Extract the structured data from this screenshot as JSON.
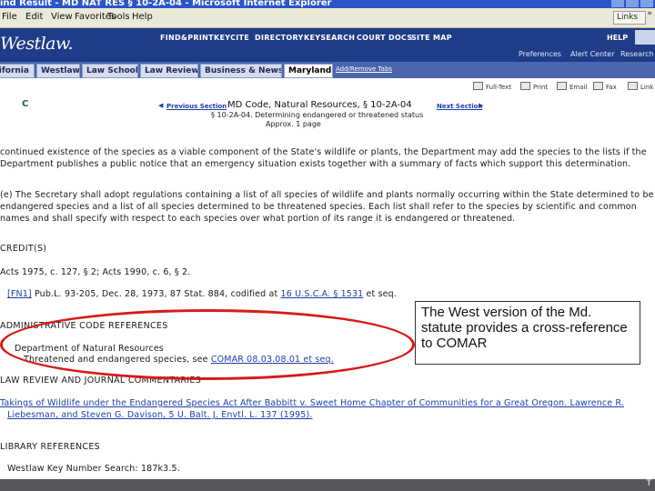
{
  "window": {
    "title": "ind Result - MD NAT RES § 10-2A-04 - Microsoft Internet Explorer"
  },
  "menu": {
    "items": [
      "File",
      "Edit",
      "View",
      "Favorites",
      "Tools",
      "Help"
    ],
    "links_label": "Links"
  },
  "westlaw": {
    "logo": "Westlaw.",
    "nav": [
      "FIND&PRINT",
      "KEYCITE",
      "DIRECTORY",
      "KEYSEARCH",
      "COURT DOCS",
      "SITE MAP"
    ],
    "help": "HELP",
    "sub_links": [
      "Preferences",
      "Alert Center",
      "Research Trail"
    ]
  },
  "tabs": {
    "items": [
      "California",
      "Westlaw",
      "Law School",
      "Law Review",
      "Business & News",
      "Maryland"
    ],
    "active": "Maryland",
    "add_remove": "Add/Remove Tabs"
  },
  "document": {
    "flag": "C",
    "prev_section": "Previous Section",
    "next_section": "Next Section",
    "title": "MD Code, Natural Resources, § 10-2A-04",
    "subtitle": "§ 10-2A-04. Determining endangered or threatened status",
    "length": "Approx. 1 page",
    "tools": [
      "Full-Text",
      "Print",
      "Email",
      "Fax",
      "Link"
    ]
  },
  "body": {
    "para1": [
      "continued existence of the species as a viable component of the State's wildlife or plants, the Department may add the species to the lists if the",
      "Department publishes a public notice that an emergency situation exists together with a summary of facts which support this determination."
    ],
    "para2": [
      "(e) The Secretary shall adopt regulations containing a list of all species of wildlife and plants normally occurring within the State determined to be",
      "endangered species and a list of all species determined to be threatened species. Each list shall refer to the species by scientific and common",
      "names and shall specify with respect to each species over what portion of its range it is endangered or threatened."
    ],
    "credits_heading": "CREDIT(S)",
    "credits_line": "Acts 1975, c. 127, § 2; Acts 1990, c. 6, § 2.",
    "fn_id": "[FN1]",
    "fn_text_a": " Pub.L. 93-205, Dec. 28, 1973, 87 Stat. 884, codified at ",
    "fn_link": "16 U.S.C.A. § 1531",
    "fn_text_b": " et seq.",
    "admin_heading": "ADMINISTRATIVE CODE REFERENCES",
    "admin_line1": "Department of Natural Resources",
    "admin_line2": "Threatened and endangered species, see ",
    "admin_link": "COMAR 08.03.08.01 et seq.",
    "lr_heading": "LAW REVIEW AND JOURNAL COMMENTARIES",
    "lr_link1": "Takings of Wildlife under the Endangered Species Act After Babbitt v. Sweet Home Chapter of Communities for a Great Oregon. Lawrence R.",
    "lr_link2": "Liebesman, and Steven G. Davison, 5 U. Balt. J. Envtl. L. 137 (1995).",
    "lib_heading": "LIBRARY REFERENCES",
    "lib_line": "Westlaw Key Number Search: 187k3.5."
  },
  "callout": {
    "text": "The West version of the Md. statute provides a cross-reference to COMAR"
  },
  "status": {
    "slide_mark": "T"
  },
  "colors": {
    "annotation_ellipse": "#d61a1a",
    "westlaw_header": "#1f3c88",
    "link": "#1a3fa8"
  }
}
